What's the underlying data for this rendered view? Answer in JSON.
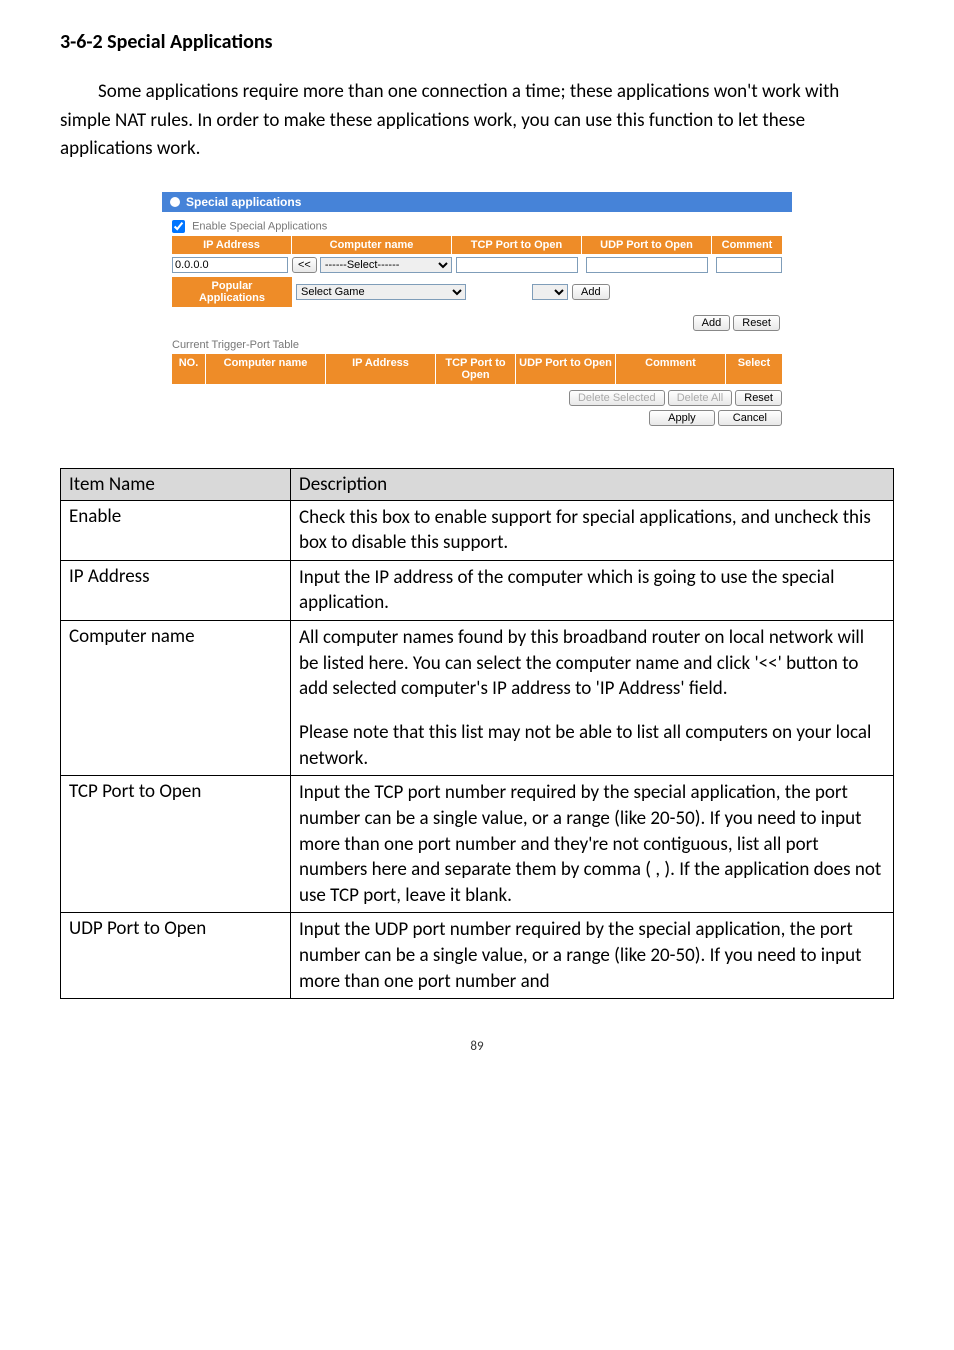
{
  "heading": "3-6-2 Special Applications",
  "paragraph": "Some applications require more than one connection a time; these applications won't work with simple NAT rules. In order to make these applications work, you can use this function to let these applications work.",
  "ui": {
    "title": "Special applications",
    "enable_label": "Enable Special Applications",
    "enable_checked": true,
    "cols": {
      "ip": "IP Address",
      "cn": "Computer name",
      "tcp": "TCP Port to Open",
      "udp": "UDP Port to Open",
      "comment": "Comment"
    },
    "ip_value": "0.0.0.0",
    "cc_btn": "<<",
    "select_placeholder": "------Select------",
    "popular_label": "Popular Applications",
    "popular_select": "Select Game",
    "add_btn": "Add",
    "reset_btn": "Reset",
    "table2_label": "Current Trigger-Port Table",
    "cols2": {
      "no": "NO.",
      "cn": "Computer name",
      "ip": "IP Address",
      "tcp": "TCP Port to Open",
      "udp": "UDP Port to Open",
      "comment": "Comment",
      "select": "Select"
    },
    "delete_selected": "Delete Selected",
    "delete_all": "Delete All",
    "apply": "Apply",
    "cancel": "Cancel"
  },
  "table": {
    "head_item": "Item Name",
    "head_desc": "Description",
    "rows": [
      {
        "item": "Enable",
        "desc": [
          "Check this box to enable support for special applications, and uncheck this box to disable this support."
        ]
      },
      {
        "item": "IP Address",
        "desc": [
          "Input the IP address of the computer which is going to use the special application."
        ]
      },
      {
        "item": "Computer name",
        "desc": [
          "All computer names found by this broadband router on local network will be listed here. You can select the computer name and click '<<' button to add selected computer's IP address to 'IP Address' field.",
          "Please note that this list may not be able to list all computers on your local network."
        ]
      },
      {
        "item": "TCP Port to Open",
        "desc": [
          "Input the TCP port number required by the special application, the port number can be a single value, or a range (like 20-50). If you need to input more than one port number and they're not contiguous, list all port numbers here and separate them by comma ( , ). If the application does not use TCP port, leave it blank."
        ]
      },
      {
        "item": "UDP Port to Open",
        "desc": [
          "Input the UDP port number required by the special application, the port number can be a single value, or a range (like 20-50). If you need to input more than one port number and"
        ]
      }
    ]
  },
  "page_number": "89"
}
